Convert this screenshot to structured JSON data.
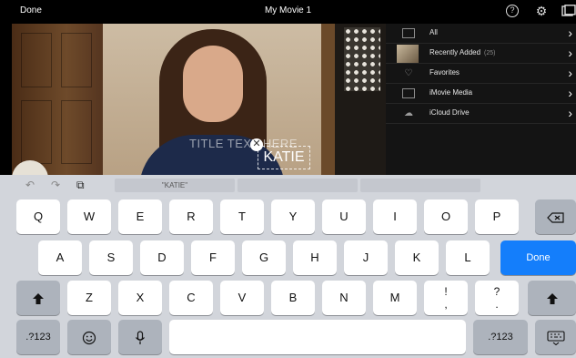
{
  "topbar": {
    "done_label": "Done",
    "title": "My Movie 1",
    "help_icon": "question-circle-icon",
    "settings_icon": "gear-icon",
    "media_icon": "media-browser-icon"
  },
  "preview": {
    "title_placeholder": "TITLE TEXT HERE",
    "title_text": "KATIE"
  },
  "library": {
    "items": [
      {
        "label": "All",
        "count": "",
        "icon": "film-icon"
      },
      {
        "label": "Recently Added",
        "count": "(25)",
        "icon": "thumbnail"
      },
      {
        "label": "Favorites",
        "count": "",
        "icon": "heart-icon"
      },
      {
        "label": "iMovie Media",
        "count": "",
        "icon": "film-icon"
      },
      {
        "label": "iCloud Drive",
        "count": "",
        "icon": "cloud-icon"
      }
    ]
  },
  "keyboard": {
    "suggestions": [
      "\"KATIE\"",
      "",
      ""
    ],
    "row1": [
      "Q",
      "W",
      "E",
      "R",
      "T",
      "Y",
      "U",
      "I",
      "O",
      "P"
    ],
    "row2": [
      "A",
      "S",
      "D",
      "F",
      "G",
      "H",
      "J",
      "K",
      "L"
    ],
    "row3": [
      "Z",
      "X",
      "C",
      "V",
      "B",
      "N",
      "M"
    ],
    "punct1_top": "!",
    "punct1_bottom": ",",
    "punct2_top": "?",
    "punct2_bottom": ".",
    "done_label": "Done",
    "numbers_label": ".?123",
    "colors": {
      "done_key": "#147efb",
      "keyboard_bg": "#d2d5db"
    }
  }
}
